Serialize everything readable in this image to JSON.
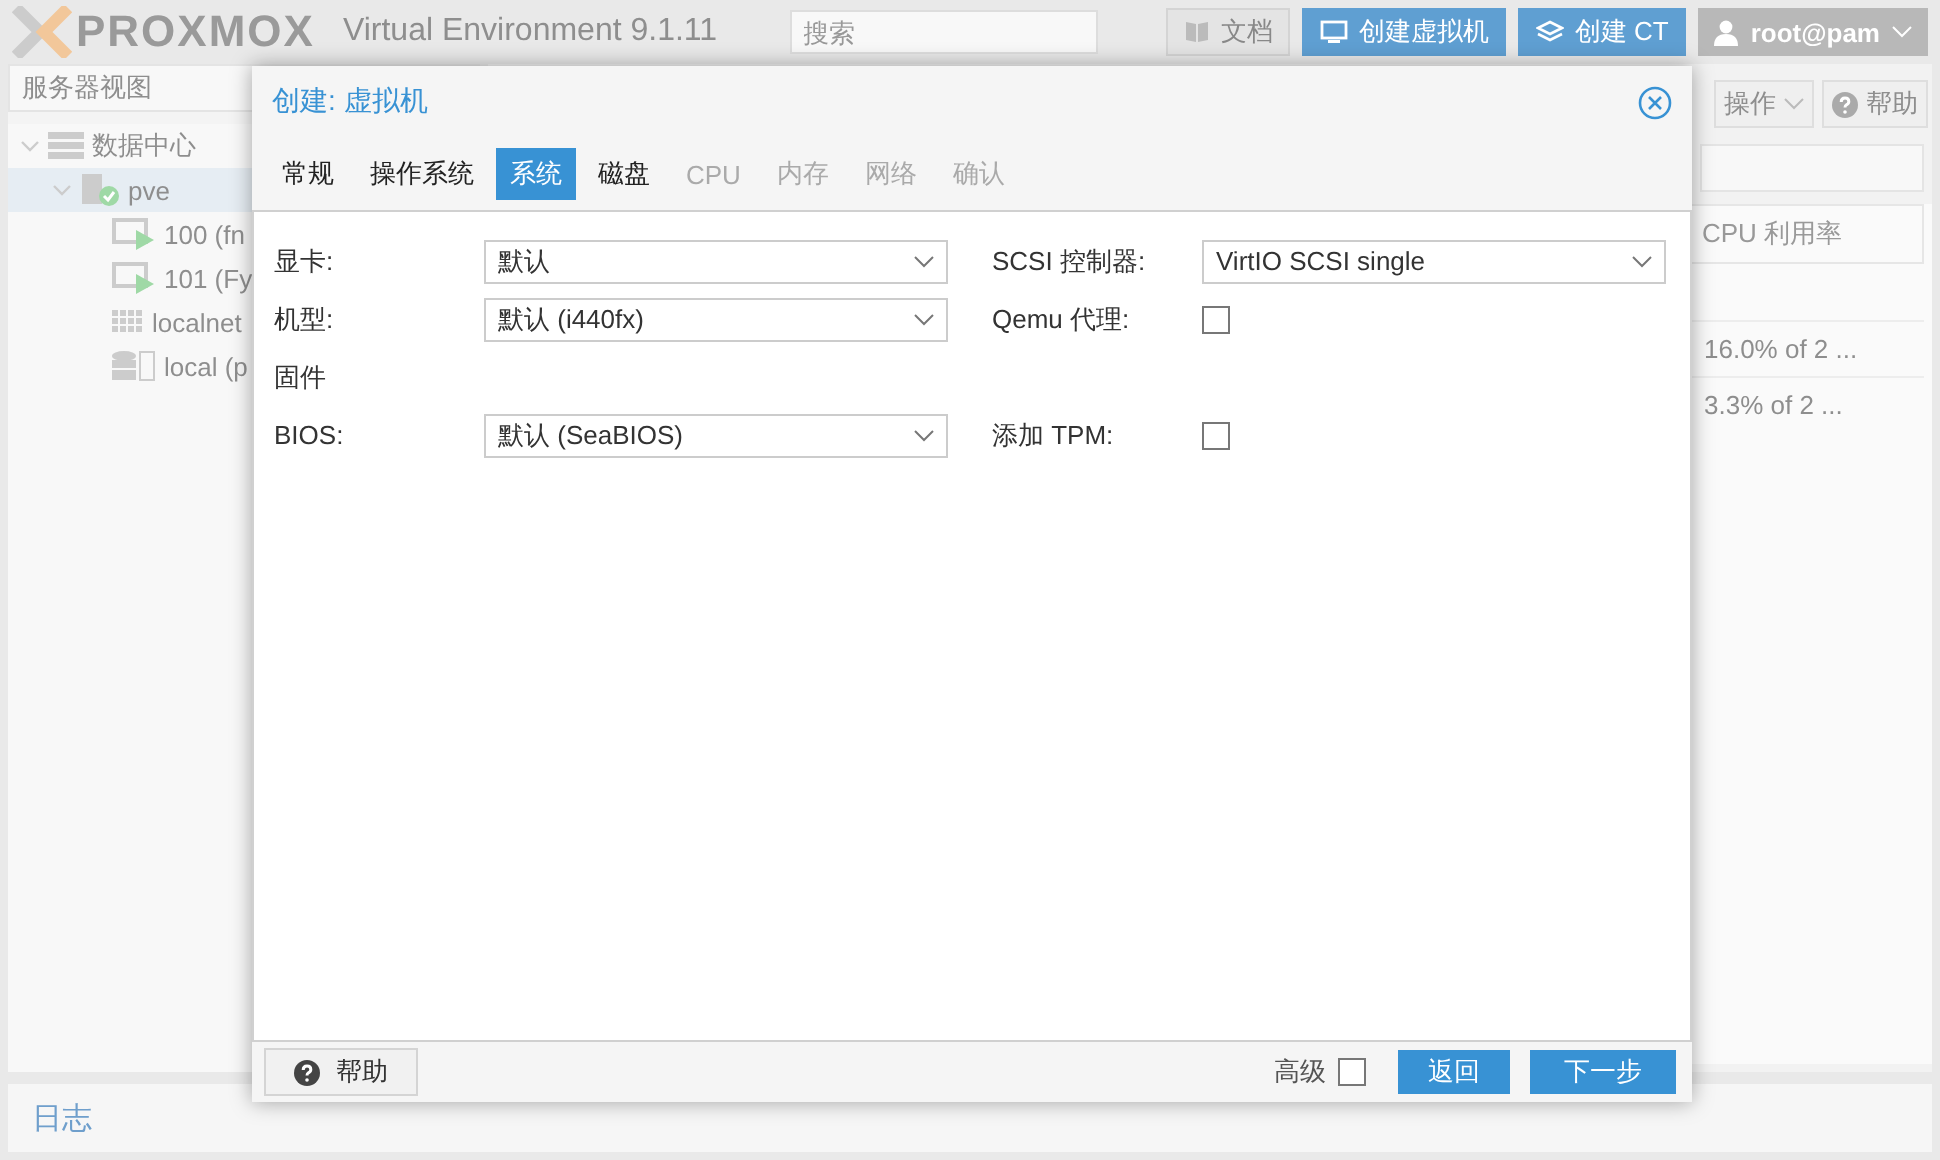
{
  "header": {
    "logo": "PROXMOX",
    "version": "Virtual Environment 9.1.11",
    "search": {
      "placeholder": "搜索"
    },
    "buttons": [
      {
        "label": "文档",
        "kind": "doc"
      },
      {
        "label": "创建虚拟机",
        "kind": "vm"
      },
      {
        "label": "创建 CT",
        "kind": "ct"
      }
    ],
    "user": "root@pam"
  },
  "sidebar": {
    "view": "服务器视图",
    "tree": [
      {
        "label": "数据中心",
        "kind": "datacenter",
        "expanded": true,
        "selected": false,
        "children": [
          {
            "label": "pve",
            "kind": "node",
            "expanded": true,
            "selected": true,
            "children": [
              {
                "label": "100 (fn",
                "kind": "vm",
                "selected": false
              },
              {
                "label": "101 (Fy",
                "kind": "vm",
                "selected": false
              },
              {
                "label": "localnet",
                "kind": "network",
                "selected": false
              },
              {
                "label": "local (p",
                "kind": "storage",
                "selected": false
              }
            ]
          }
        ]
      }
    ]
  },
  "toolbar": {
    "buttons": [
      {
        "label": "操作",
        "kind": "menu"
      },
      {
        "label": "帮助",
        "kind": "help"
      }
    ]
  },
  "table": {
    "columns": [
      "CPU 利用率"
    ],
    "rows": [
      [
        "16.0% of 2 ..."
      ],
      [
        "3.3% of 2 ..."
      ]
    ]
  },
  "log_panel": {
    "title": "日志"
  },
  "dialog": {
    "title": "创建: 虚拟机",
    "tabs": [
      {
        "label": "常规",
        "selected": false,
        "disabled": false
      },
      {
        "label": "操作系统",
        "selected": false,
        "disabled": false
      },
      {
        "label": "系统",
        "selected": true,
        "disabled": false
      },
      {
        "label": "磁盘",
        "selected": false,
        "disabled": false
      },
      {
        "label": "CPU",
        "selected": false,
        "disabled": true
      },
      {
        "label": "内存",
        "selected": false,
        "disabled": true
      },
      {
        "label": "网络",
        "selected": false,
        "disabled": true
      },
      {
        "label": "确认",
        "selected": false,
        "disabled": true
      }
    ],
    "rows": [
      {
        "left": {
          "kind": "combo",
          "label": "显卡:",
          "value": "默认"
        },
        "right": {
          "kind": "combo",
          "label": "SCSI 控制器:",
          "value": "VirtIO SCSI single"
        }
      },
      {
        "left": {
          "kind": "combo",
          "label": "机型:",
          "value": "默认 (i440fx)"
        },
        "right": {
          "kind": "checkbox",
          "label": "Qemu 代理:",
          "checked": false
        }
      },
      {
        "left": {
          "kind": "section",
          "label": "固件"
        }
      },
      {
        "left": {
          "kind": "combo",
          "label": "BIOS:",
          "value": "默认 (SeaBIOS)"
        },
        "right": {
          "kind": "checkbox",
          "label": "添加 TPM:",
          "checked": false
        }
      }
    ],
    "footer": {
      "help": "帮助",
      "advanced": {
        "label": "高级",
        "checked": false
      },
      "buttons": [
        {
          "label": "返回",
          "kind": "back"
        },
        {
          "label": "下一步",
          "kind": "next"
        }
      ]
    }
  }
}
